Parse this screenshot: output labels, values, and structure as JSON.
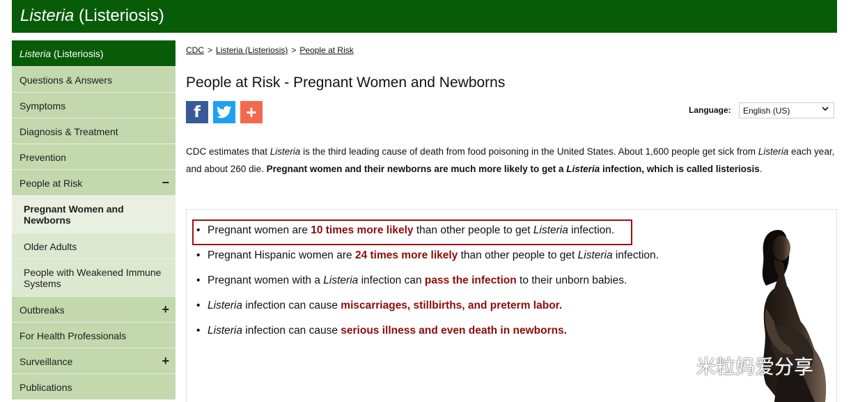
{
  "banner": {
    "title_italic": "Listeria",
    "title_rest": " (Listeriosis)"
  },
  "sidebar": {
    "top": {
      "italic": "Listeria",
      "rest": " (Listeriosis)"
    },
    "items": [
      {
        "label": "Questions & Answers"
      },
      {
        "label": "Symptoms"
      },
      {
        "label": "Diagnosis & Treatment"
      },
      {
        "label": "Prevention"
      },
      {
        "label": "People at Risk",
        "toggle": "−"
      },
      {
        "label": "Pregnant Women and Newborns"
      },
      {
        "label": "Older Adults"
      },
      {
        "label": "People with Weakened Immune Systems"
      },
      {
        "label": "Outbreaks",
        "toggle": "+"
      },
      {
        "label": "For Health Professionals"
      },
      {
        "label": "Surveillance",
        "toggle": "+"
      },
      {
        "label": "Publications"
      }
    ]
  },
  "breadcrumb": {
    "items": [
      "CDC",
      "Listeria (Listeriosis)",
      "People at Risk"
    ],
    "separator": ">"
  },
  "page": {
    "title": "People at Risk - Pregnant Women and Newborns"
  },
  "share": {
    "facebook": "f",
    "add": "+"
  },
  "language": {
    "label": "Language:",
    "selected": "English (US)"
  },
  "intro": {
    "p1": "CDC estimates that ",
    "p2": "Listeria",
    "p3": " is the third leading cause of death from food poisoning in the United States. About 1,600 people get sick from ",
    "p4": "Listeria",
    "p5": " each year, and about 260 die. ",
    "b1": "Pregnant women and their newborns are much more likely to get a ",
    "b2": "Listeria",
    "b3": " infection, which is called listeriosis",
    "end": "."
  },
  "facts": [
    {
      "a": "Pregnant women are ",
      "red": "10 times more likely",
      "b": " than other people to get ",
      "i": "Listeria",
      "c": " infection."
    },
    {
      "a": "Pregnant Hispanic women are ",
      "red": "24 times more likely",
      "b": " than other people to get ",
      "i": "Listeria",
      "c": " infection."
    },
    {
      "a": "Pregnant women with a ",
      "i": "Listeria",
      "b": " infection can ",
      "red": "pass the infection",
      "c": " to their unborn babies."
    },
    {
      "i": "Listeria",
      "a": " infection can cause ",
      "red": "miscarriages, stillbirths, and preterm labor."
    },
    {
      "i": "Listeria",
      "a": " infection can cause ",
      "red": "serious illness and even death in newborns."
    }
  ],
  "bullet": "•",
  "watermark": {
    "text": "米粒妈爱分享"
  },
  "colors": {
    "brand_green": "#085c08",
    "nav_green": "#c3d8ad",
    "highlight_red": "#a00f13",
    "emphasis_red": "#8e0b0b"
  }
}
